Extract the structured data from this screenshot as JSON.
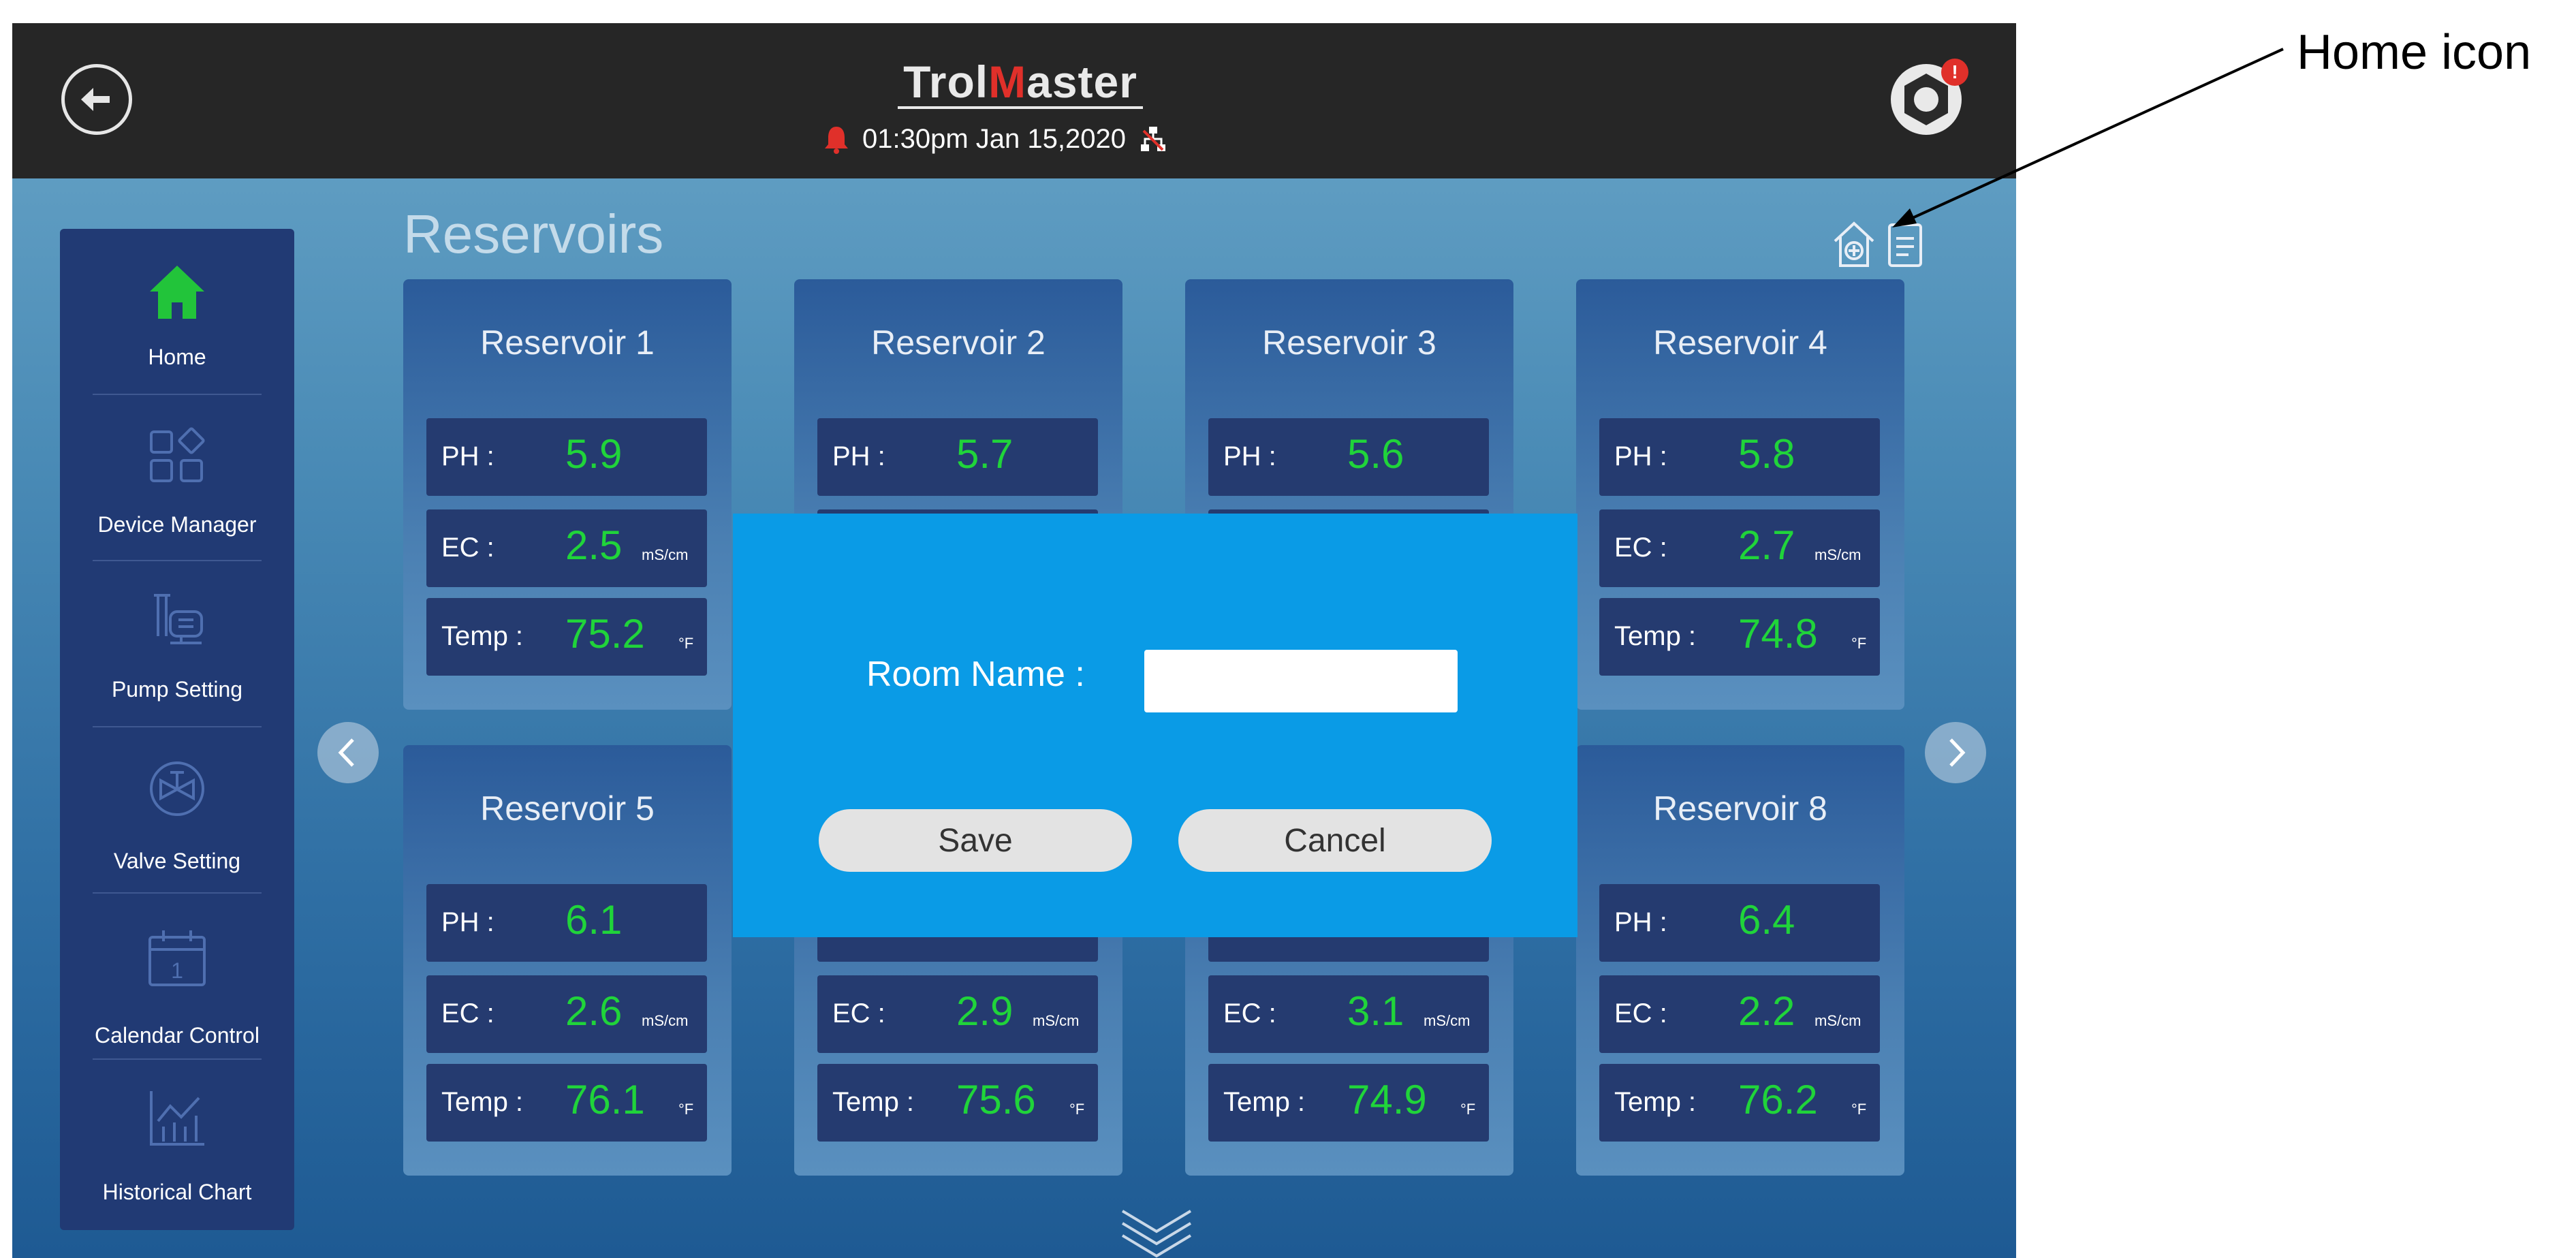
{
  "header": {
    "brand_pre": "Trol",
    "brand_m": "M",
    "brand_post": "aster",
    "datetime": "01:30pm  Jan 15,2020",
    "alert_badge": "!"
  },
  "sidebar": {
    "items": [
      {
        "label": "Home",
        "icon": "home-icon",
        "active": true
      },
      {
        "label": "Device Manager",
        "icon": "device-manager-icon"
      },
      {
        "label": "Pump Setting",
        "icon": "pump-icon"
      },
      {
        "label": "Valve Setting",
        "icon": "valve-icon"
      },
      {
        "label": "Calendar Control",
        "icon": "calendar-icon",
        "calendar_day": "1"
      },
      {
        "label": "Historical Chart",
        "icon": "chart-icon"
      }
    ]
  },
  "main": {
    "title": "Reservoirs",
    "labels": {
      "ph": "PH :",
      "ec": "EC :",
      "temp": "Temp :"
    },
    "units": {
      "ec": "mS/cm",
      "temp": "°F"
    },
    "reservoirs": [
      {
        "name": "Reservoir 1",
        "ph": "5.9",
        "ec": "2.5",
        "temp": "75.2"
      },
      {
        "name": "Reservoir 2",
        "ph": "5.7"
      },
      {
        "name": "Reservoir 3",
        "ph": "5.6"
      },
      {
        "name": "Reservoir 4",
        "ph": "5.8",
        "ec": "2.7",
        "temp": "74.8"
      },
      {
        "name": "Reservoir 5",
        "ph": "6.1",
        "ec": "2.6",
        "temp": "76.1"
      },
      {
        "ec": "2.9",
        "temp": "75.6"
      },
      {
        "ec": "3.1",
        "temp": "74.9"
      },
      {
        "name": "Reservoir 8",
        "ph": "6.4",
        "ec": "2.2",
        "temp": "76.2"
      }
    ]
  },
  "dialog": {
    "room_name_label": "Room Name :",
    "room_name_value": "",
    "save_label": "Save",
    "cancel_label": "Cancel"
  },
  "annotation": {
    "label": "Home icon"
  },
  "colors": {
    "topbar": "#262626",
    "accent_red": "#e0302a",
    "value_green": "#20d43a",
    "sidebar": "#213a74",
    "modal": "#0a9be6",
    "active_icon": "#22c43a"
  }
}
